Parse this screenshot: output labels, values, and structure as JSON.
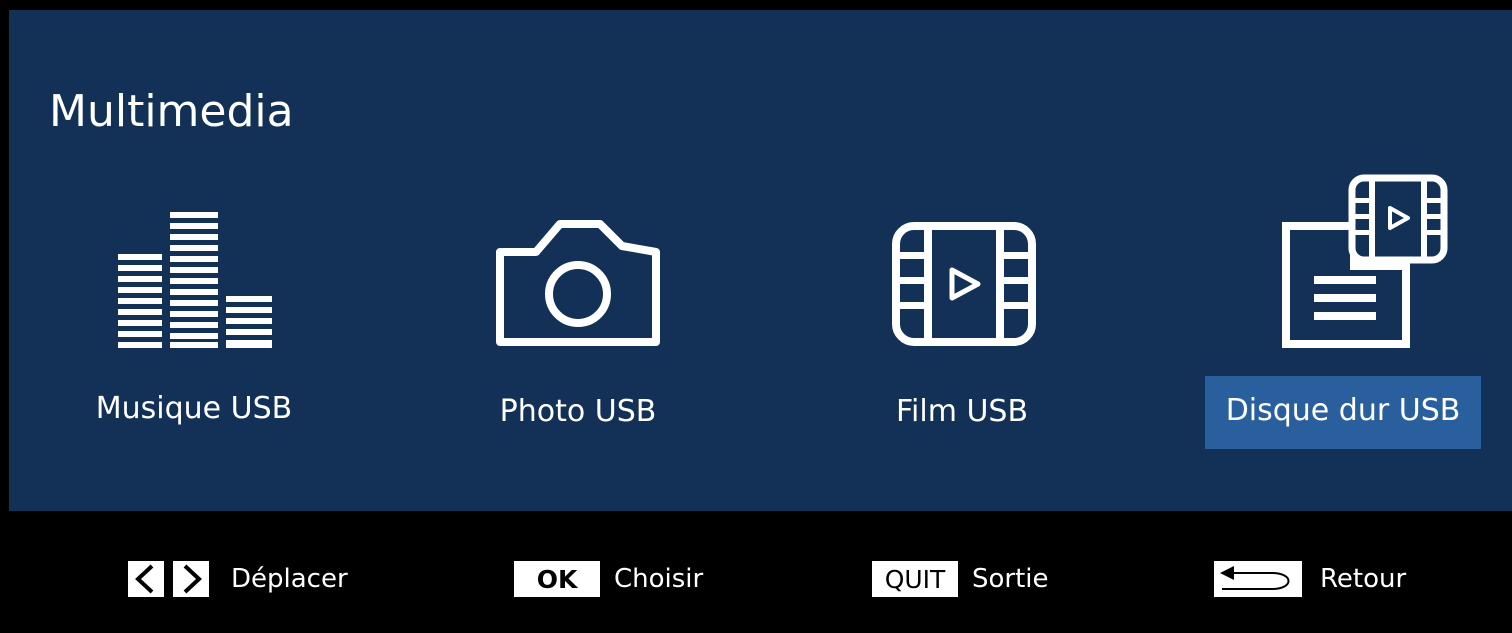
{
  "header": {
    "title": "Multimedia"
  },
  "items": [
    {
      "label": "Musique USB",
      "icon": "equalizer-bars-icon",
      "selected": false
    },
    {
      "label": "Photo USB",
      "icon": "camera-icon",
      "selected": false
    },
    {
      "label": "Film USB",
      "icon": "film-strip-icon",
      "selected": false
    },
    {
      "label": "Disque dur USB",
      "icon": "usb-drive-files-icon",
      "selected": true
    }
  ],
  "footer": {
    "hints": [
      {
        "key": "",
        "icon": "left-right-arrows-icon",
        "label": "Déplacer"
      },
      {
        "key": "OK",
        "label": "Choisir"
      },
      {
        "key": "QUIT",
        "label": "Sortie"
      },
      {
        "key": "",
        "icon": "return-arrow-icon",
        "label": "Retour"
      }
    ]
  },
  "colors": {
    "panel": "#133157",
    "selected_highlight": "#2a5f9e",
    "footer": "#000000",
    "text": "#ffffff"
  }
}
